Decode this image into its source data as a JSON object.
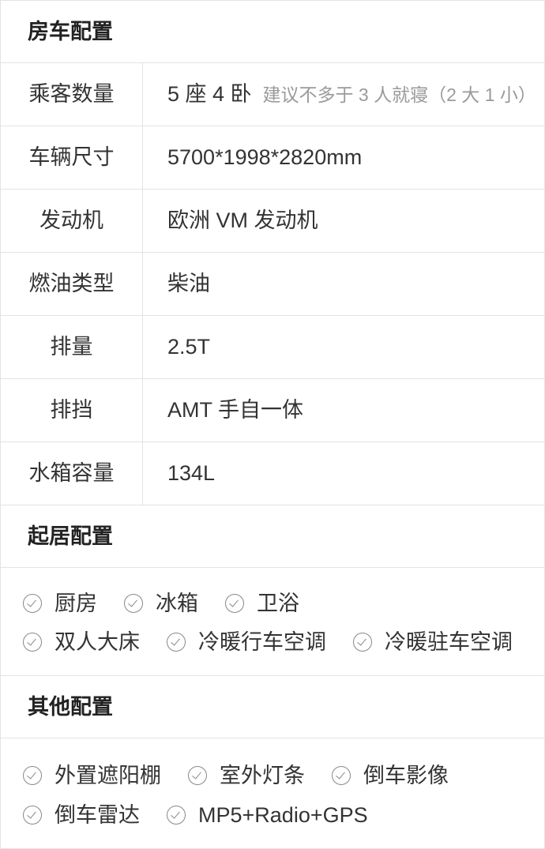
{
  "sections": {
    "rv_config": "房车配置",
    "living_config": "起居配置",
    "other_config": "其他配置"
  },
  "specs": [
    {
      "label": "乘客数量",
      "value": "5 座 4 卧",
      "note": "建议不多于 3 人就寝（2 大 1 小）"
    },
    {
      "label": "车辆尺寸",
      "value": "5700*1998*2820mm"
    },
    {
      "label": "发动机",
      "value": "欧洲 VM 发动机"
    },
    {
      "label": "燃油类型",
      "value": "柴油"
    },
    {
      "label": "排量",
      "value": "2.5T"
    },
    {
      "label": "排挡",
      "value": "AMT 手自一体"
    },
    {
      "label": "水箱容量",
      "value": "134L"
    }
  ],
  "living_features": [
    "厨房",
    "冰箱",
    "卫浴",
    "双人大床",
    "冷暖行车空调",
    "冷暖驻车空调"
  ],
  "other_features": [
    "外置遮阳棚",
    "室外灯条",
    "倒车影像",
    "倒车雷达",
    "MP5+Radio+GPS"
  ],
  "icons": {
    "feature_check": "check-circle-icon"
  },
  "colors": {
    "text": "#333333",
    "note": "#9a9a9a",
    "border": "#e3e3e3",
    "icon": "#888888"
  }
}
